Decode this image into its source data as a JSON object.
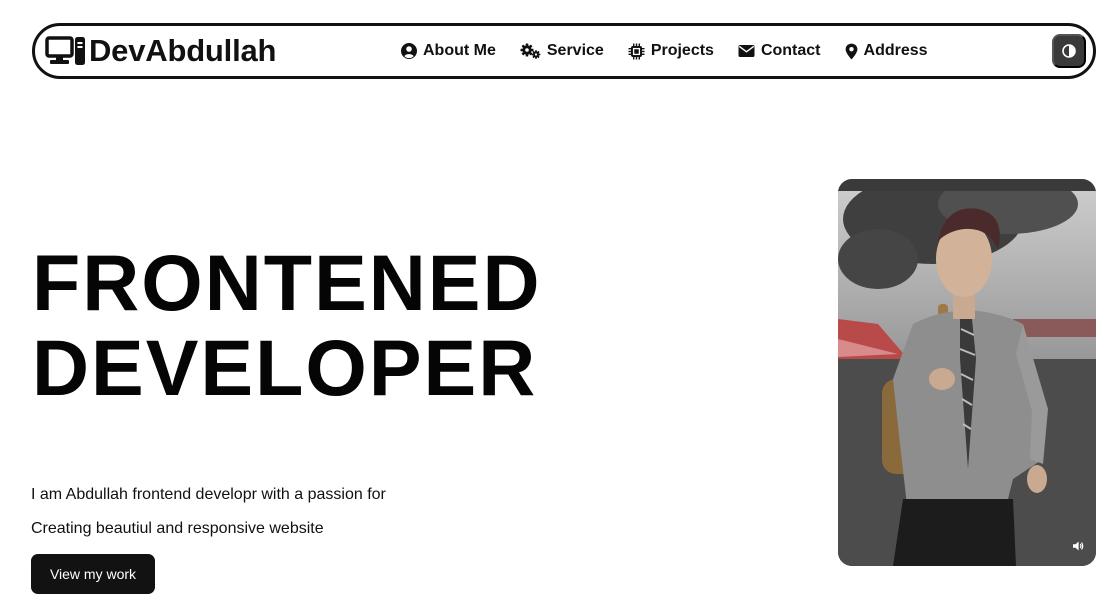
{
  "brand": {
    "name": "DevAbdullah",
    "icon": "desktop-computer-icon"
  },
  "nav": {
    "items": [
      {
        "label": "About Me",
        "icon": "user-circle-icon"
      },
      {
        "label": "Service",
        "icon": "gears-icon"
      },
      {
        "label": "Projects",
        "icon": "microchip-icon"
      },
      {
        "label": "Contact",
        "icon": "envelope-icon"
      },
      {
        "label": "Address",
        "icon": "map-pin-icon"
      }
    ],
    "theme_toggle_icon": "contrast-icon"
  },
  "hero": {
    "title_line1": "FRONTENED",
    "title_line2": "DEVELOPER",
    "description_line1": "I am Abdullah frontend developr with a passion for",
    "description_line2": "Creating beautiul and responsive website",
    "cta_label": "View my work"
  },
  "media": {
    "subject": "portrait-photo",
    "control_icon": "volume-icon"
  },
  "colors": {
    "text": "#111111",
    "background": "#ffffff",
    "button": "#121212",
    "toggle": "#3a3a3a"
  }
}
